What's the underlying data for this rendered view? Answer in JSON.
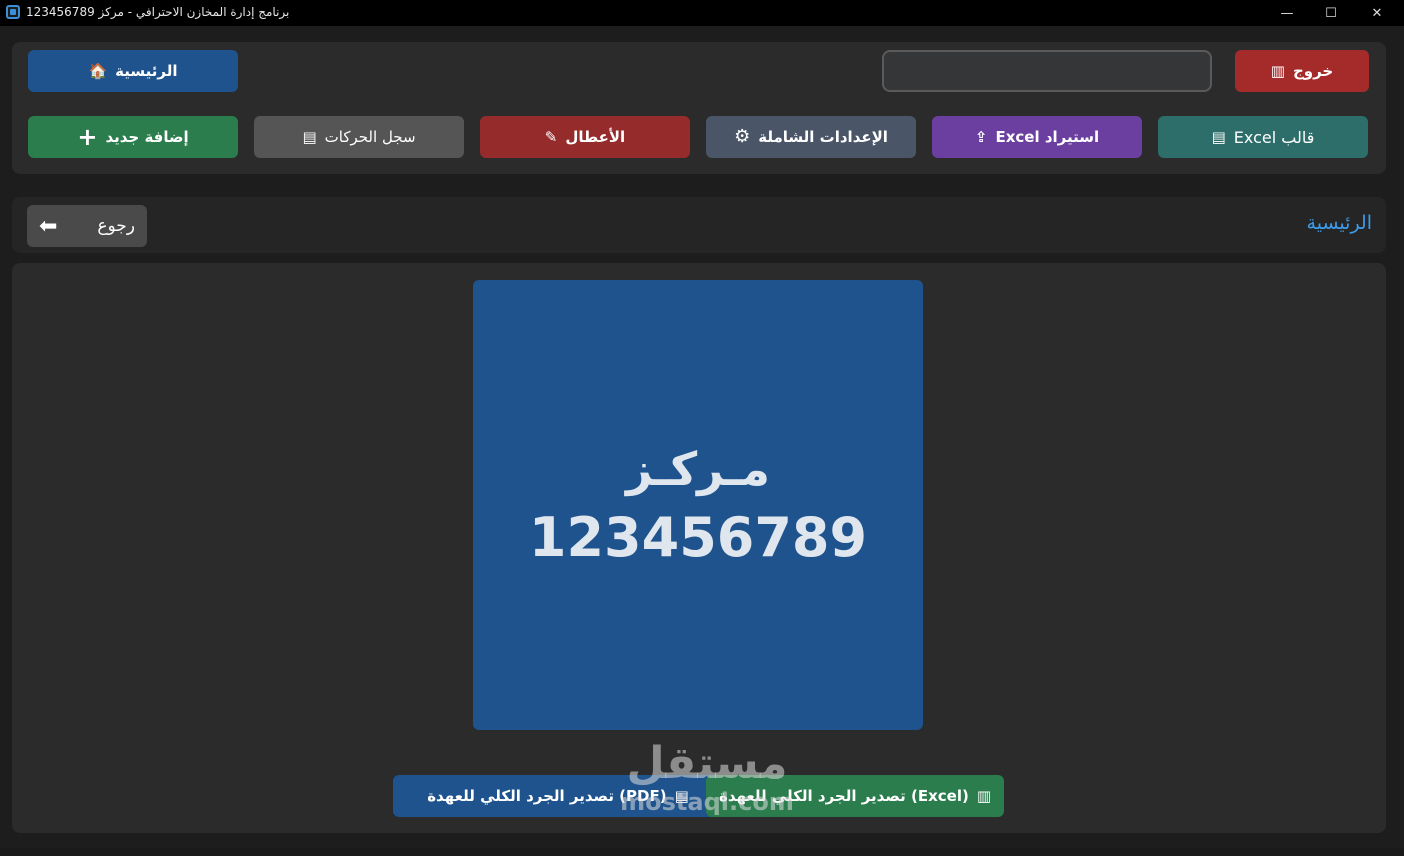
{
  "window": {
    "title": "برنامج إدارة المخازن الاحترافي - مركز 123456789",
    "minimize_icon": "—",
    "maximize_icon": "☐",
    "close_icon": "✕"
  },
  "toolbar": {
    "home": {
      "label": "الرئيسية",
      "icon": "🏠",
      "color": "#1f538d"
    },
    "exit": {
      "label": "خروج",
      "icon": "▥",
      "color": "#a52a2a"
    },
    "search": {
      "value": "",
      "placeholder": ""
    },
    "add_new": {
      "label": "إضافة جديد",
      "icon": "+",
      "color": "#2b7d4e"
    },
    "movements_log": {
      "label": "سجل الحركات",
      "icon": "▤",
      "color": "#555555"
    },
    "faults": {
      "label": "الأعطال",
      "icon": "✎",
      "color": "#962b2b"
    },
    "global_settings": {
      "label": "الإعدادات الشاملة",
      "icon": "⚙",
      "color": "#4a5568"
    },
    "import_excel": {
      "label": "استيراد Excel",
      "icon": "⇪",
      "color": "#6b3fa0"
    },
    "excel_template": {
      "label": "قالب Excel",
      "icon": "▤",
      "color": "#2d6e6a"
    }
  },
  "nav": {
    "title": "الرئيسية",
    "back_label": "رجوع",
    "back_icon": "⬅"
  },
  "center_card": {
    "name": "مـركـز",
    "number": "123456789",
    "color": "#1f538d"
  },
  "actions": {
    "export_pdf": {
      "label": "(PDF) تصدير الجرد الكلي للعهدة",
      "icon": "▤",
      "color": "#1f538d"
    },
    "export_excel": {
      "label": "(Excel) تصدير الجرد الكلي للعهدة",
      "icon": "▥",
      "color": "#2b7d4e"
    }
  },
  "watermark": {
    "arabic": "مستقل",
    "english": "mostaql.com"
  }
}
